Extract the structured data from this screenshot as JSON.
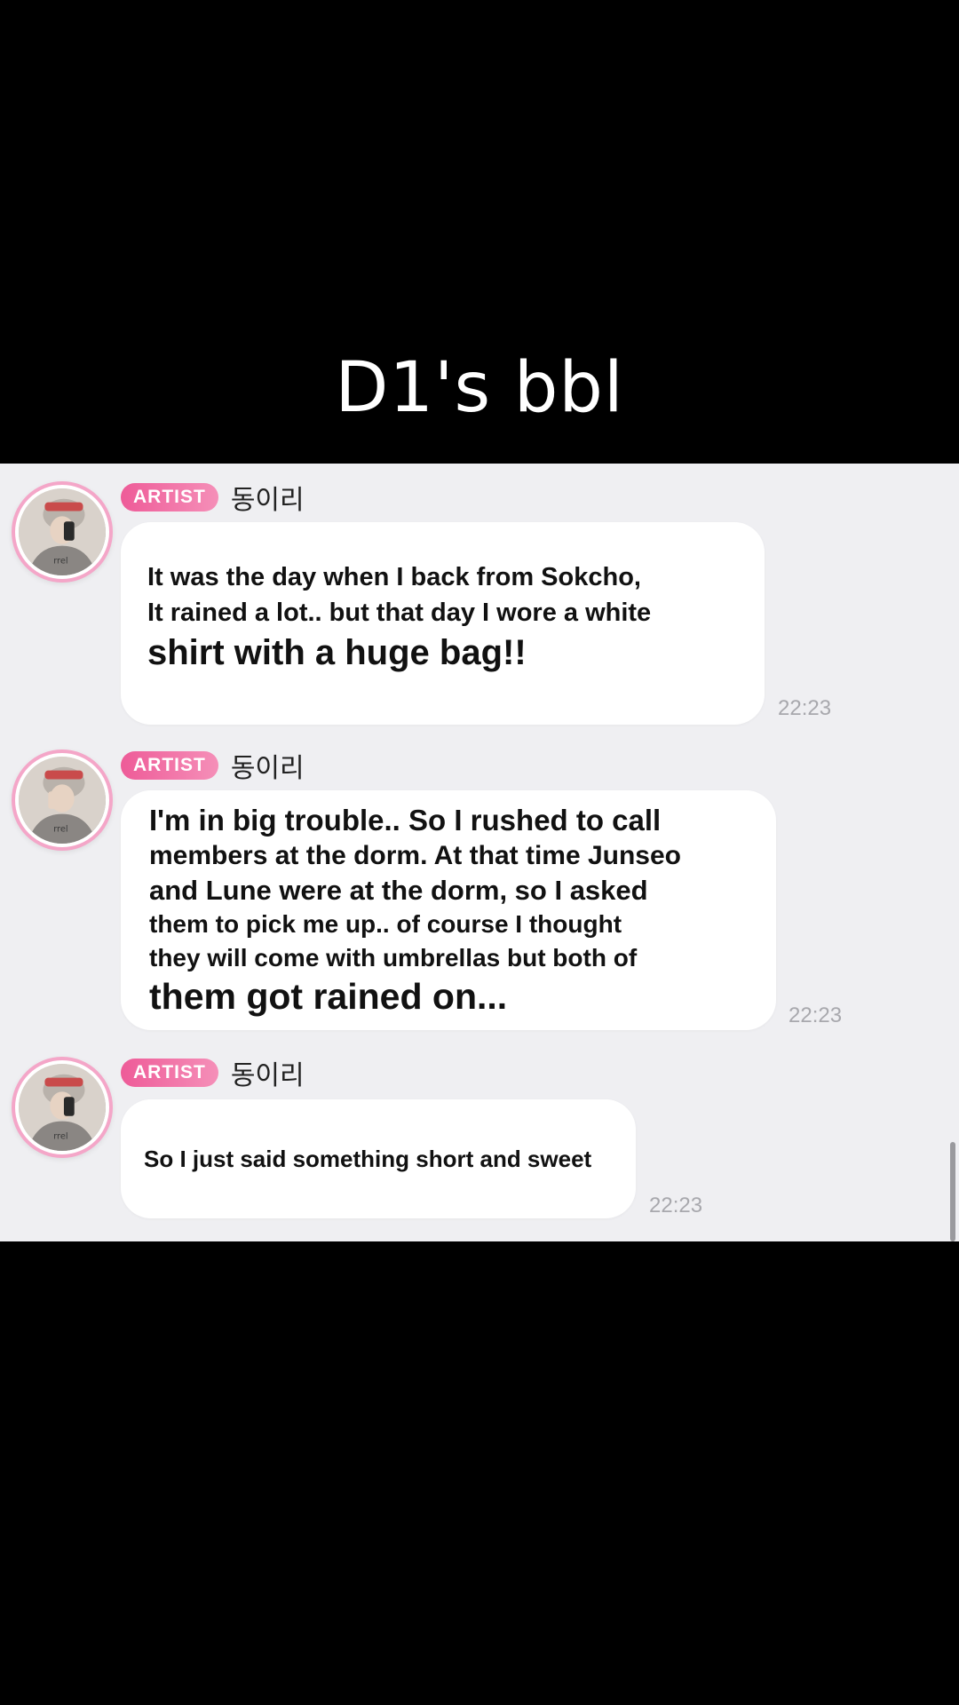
{
  "video": {
    "title": "D1's bbl"
  },
  "chat": {
    "badge_color": "#ee5b98",
    "messages": [
      {
        "badge": "ARTIST",
        "sender": "동이리",
        "lines": [
          "It was the day when I back from Sokcho,",
          "It rained a lot.. but that day I wore a white",
          "shirt with a huge bag!!"
        ],
        "time": "22:23"
      },
      {
        "badge": "ARTIST",
        "sender": "동이리",
        "lines": [
          "I'm in big trouble.. So I rushed to call",
          "members at the dorm. At that time Junseo",
          "and Lune were at the dorm, so I asked",
          "them to pick me up.. of course I thought",
          "they will come with umbrellas but both of",
          "them got rained on..."
        ],
        "time": "22:23"
      },
      {
        "badge": "ARTIST",
        "sender": "동이리",
        "lines": [
          "So I just said something short and sweet"
        ],
        "time": "22:23"
      }
    ]
  }
}
